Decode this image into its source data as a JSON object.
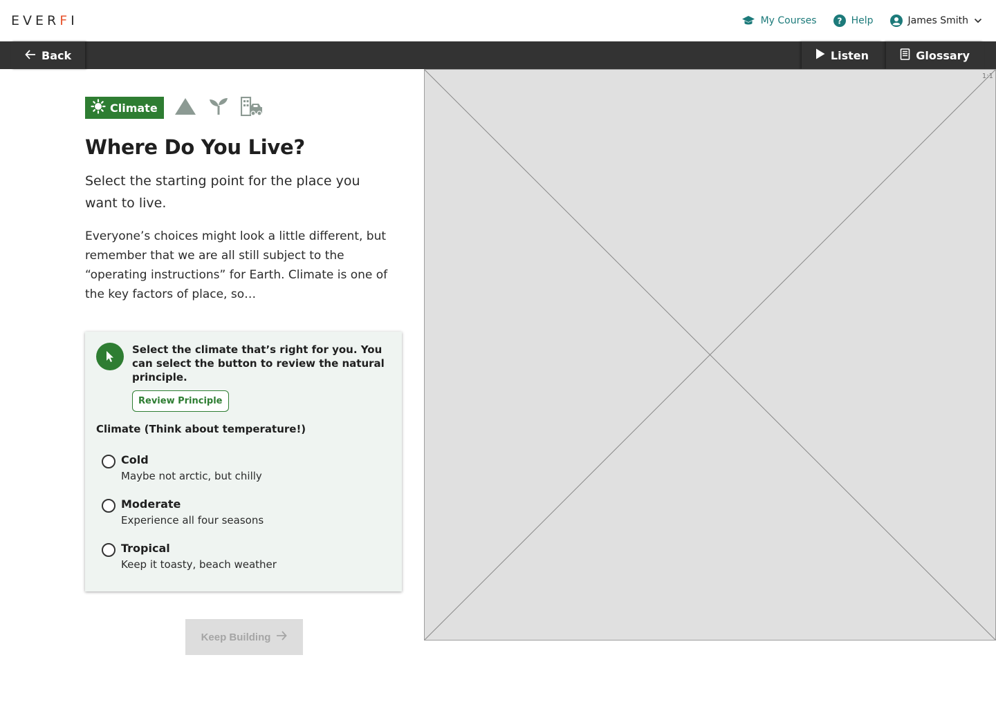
{
  "header": {
    "logo": {
      "text_main": "EVER",
      "text_accent": "F",
      "text_end": "I"
    },
    "nav": {
      "my_courses": "My Courses",
      "help": "Help",
      "user_name": "James Smith"
    }
  },
  "toolbar": {
    "back": "Back",
    "listen": "Listen",
    "glossary": "Glossary"
  },
  "tabs": {
    "active_label": "Climate",
    "others": [
      "mountain-icon",
      "sprout-icon",
      "city-icon"
    ]
  },
  "main": {
    "title": "Where Do You Live?",
    "subtitle": "Select the starting point for the place you want to live.",
    "body": "Everyone’s choices might look a little different, but remember that we are all still subject to the “operating instructions” for Earth. Climate is one of the key factors of place, so…"
  },
  "card": {
    "instruction": "Select the climate that’s right for you. You can select the button to review the natural principle.",
    "review_button": "Review Principle",
    "group_label": "Climate (Think about temperature!)",
    "options": [
      {
        "title": "Cold",
        "desc": "Maybe not arctic, but chilly"
      },
      {
        "title": "Moderate",
        "desc": "Experience all four seasons"
      },
      {
        "title": "Tropical",
        "desc": "Keep it toasty, beach weather"
      }
    ]
  },
  "keep_building": "Keep Building",
  "image_placeholder": {
    "ratio": "1:1"
  },
  "colors": {
    "brand_green": "#2e7d32",
    "teal_link": "#1c7a7a",
    "toolbar_bg": "#333333",
    "logo_accent": "#e8552f"
  }
}
